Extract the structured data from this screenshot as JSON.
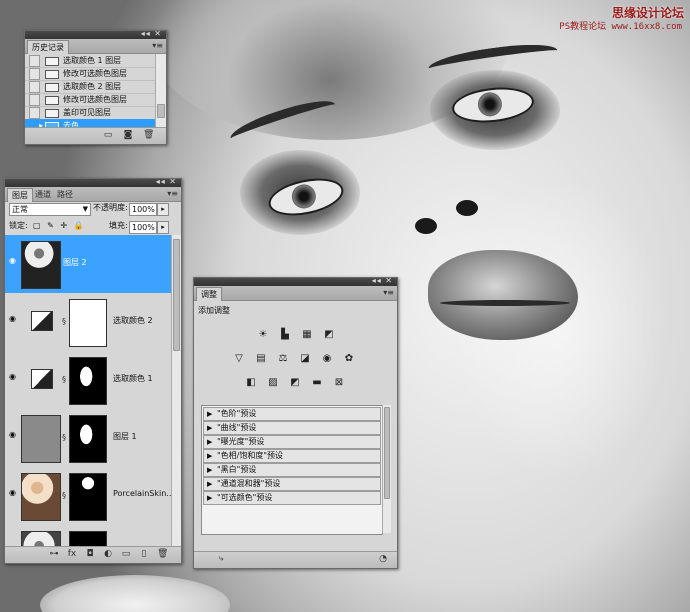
{
  "watermark": {
    "cn": "思缘设计论坛",
    "url": "PS教程论坛 www.16xx8.com"
  },
  "history_panel": {
    "title": "历史记录",
    "items": [
      {
        "label": "选取颜色 1 图层"
      },
      {
        "label": "修改可选颜色图层"
      },
      {
        "label": "选取颜色 2 图层"
      },
      {
        "label": "修改可选颜色图层"
      },
      {
        "label": "盖印可见图层"
      },
      {
        "label": "去色",
        "active": true
      }
    ]
  },
  "layers_panel": {
    "tabs": [
      "图层",
      "通道",
      "路径"
    ],
    "blend_mode": "正常",
    "opacity_label": "不透明度:",
    "opacity_value": "100%",
    "lock_label": "锁定:",
    "fill_label": "填充:",
    "fill_value": "100%",
    "layers": [
      {
        "name": "图层 2",
        "active": true
      },
      {
        "name": "选取颜色 2"
      },
      {
        "name": "选取颜色 1"
      },
      {
        "name": "图层 1"
      },
      {
        "name": "PorcelainSkin..."
      },
      {
        "name": ""
      }
    ]
  },
  "adjustments_panel": {
    "tab": "调整",
    "title": "添加调整",
    "presets": [
      "\"色阶\"预设",
      "\"曲线\"预设",
      "\"曝光度\"预设",
      "\"色相/饱和度\"预设",
      "\"黑白\"预设",
      "\"通道混和器\"预设",
      "\"可选颜色\"预设"
    ]
  }
}
